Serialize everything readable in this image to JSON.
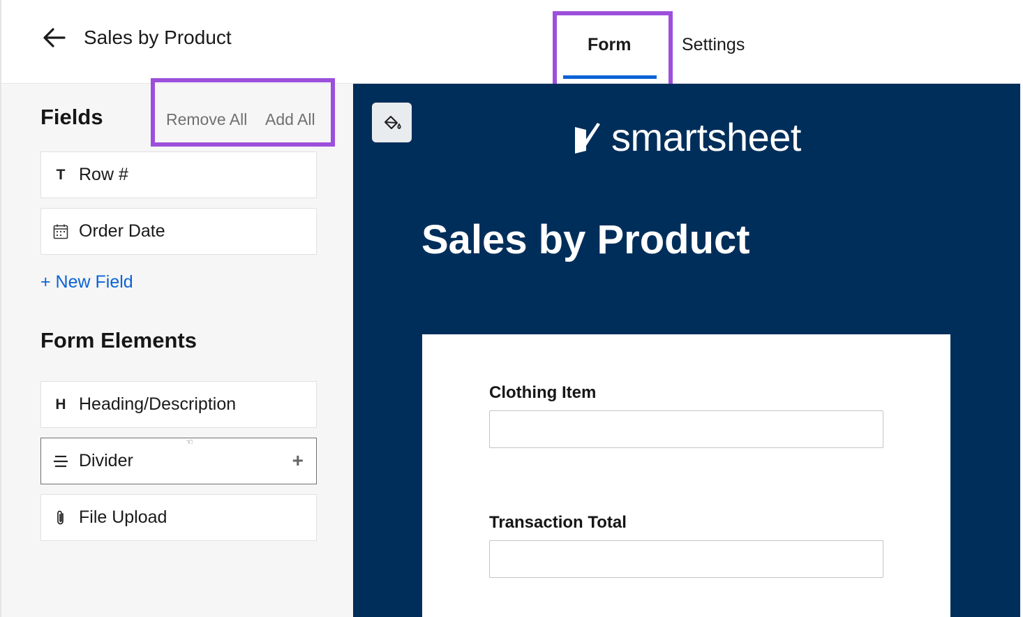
{
  "header": {
    "title": "Sales by Product",
    "tabs": [
      {
        "label": "Form",
        "active": true
      },
      {
        "label": "Settings",
        "active": false
      }
    ]
  },
  "sidebar": {
    "fields_title": "Fields",
    "remove_all": "Remove All",
    "add_all": "Add All",
    "fields": [
      {
        "icon": "text-type-icon",
        "icon_glyph": "T",
        "label": "Row #"
      },
      {
        "icon": "calendar-icon",
        "label": "Order Date"
      }
    ],
    "new_field": "+ New Field",
    "elements_title": "Form Elements",
    "elements": [
      {
        "icon": "heading-icon",
        "icon_glyph": "H",
        "label": "Heading/Description"
      },
      {
        "icon": "divider-icon",
        "label": "Divider",
        "plus": "+"
      },
      {
        "icon": "paperclip-icon",
        "label": "File Upload"
      }
    ]
  },
  "preview": {
    "logo_text": "smartsheet",
    "form_title": "Sales by Product",
    "questions": [
      {
        "label": "Clothing Item",
        "value": ""
      },
      {
        "label": "Transaction Total",
        "value": ""
      }
    ]
  },
  "colors": {
    "accent_blue": "#0b63d6",
    "highlight_purple": "#9c4fdb",
    "preview_bg": "#002e5a"
  }
}
